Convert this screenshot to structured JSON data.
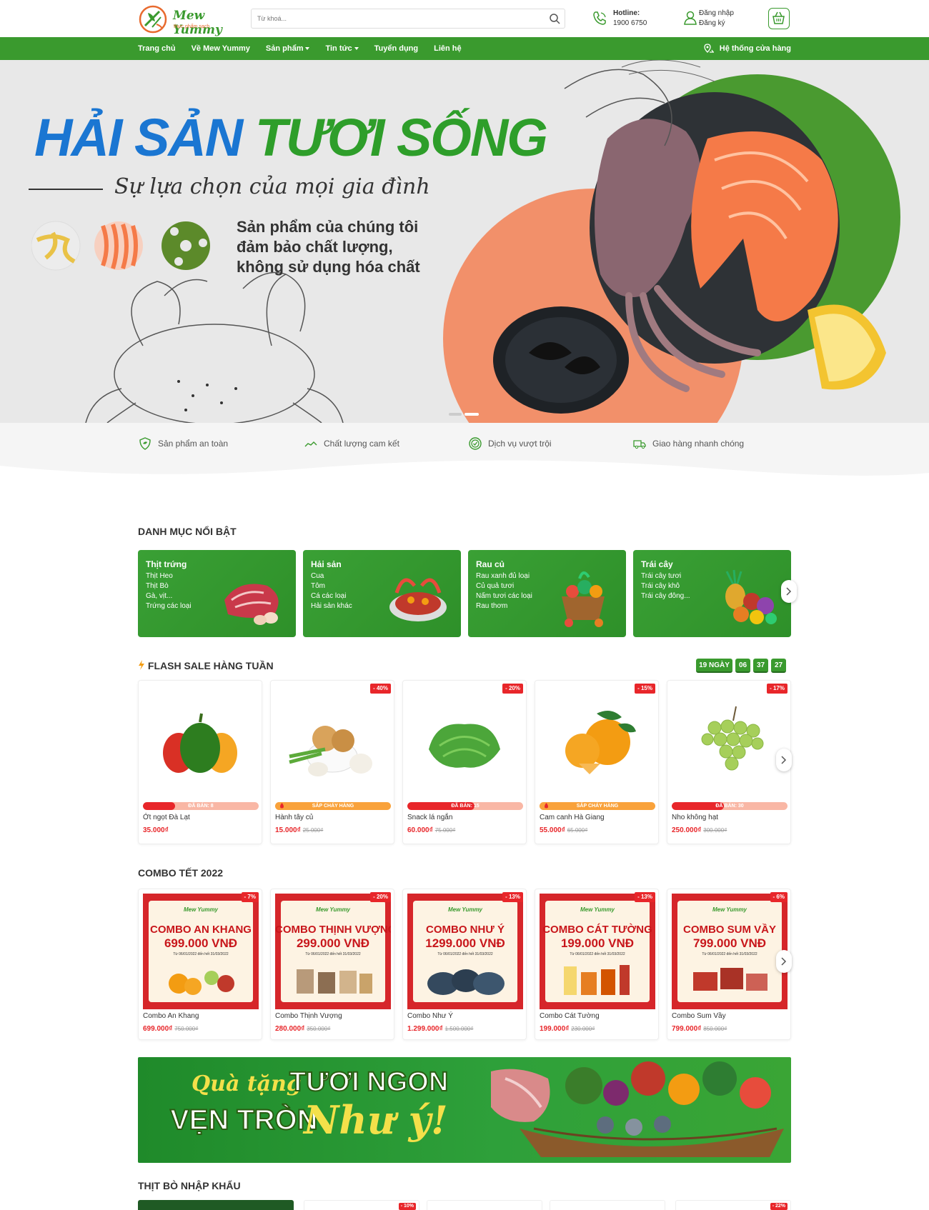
{
  "header": {
    "brand_name": "Mew Yummy",
    "brand_tagline": "thực phẩm sạch",
    "search_placeholder": "Từ khoá...",
    "hotline_label": "Hotline:",
    "hotline_number": "1900 6750",
    "login": "Đăng nhập",
    "register": "Đăng ký"
  },
  "nav": {
    "items": [
      "Trang chủ",
      "Về Mew Yummy",
      "Sản phẩm",
      "Tin tức",
      "Tuyển dụng",
      "Liên hệ"
    ],
    "stores": "Hệ thống cửa hàng"
  },
  "hero": {
    "title_part1": "HẢI SẢN",
    "title_part2": "TƯƠI SỐNG",
    "subtitle": "Sự lựa chọn của mọi gia đình",
    "desc": "Sản phẩm của chúng tôi đảm bảo chất lượng, không sử dụng hóa chất"
  },
  "features": [
    "Sản phẩm an toàn",
    "Chất lượng cam kết",
    "Dịch vụ vượt trội",
    "Giao hàng nhanh chóng"
  ],
  "categories": {
    "title": "DANH MỤC NỔI BẬT",
    "items": [
      {
        "name": "Thịt trứng",
        "sub": [
          "Thịt Heo",
          "Thịt Bò",
          "Gà, vịt...",
          "Trứng các loại"
        ]
      },
      {
        "name": "Hải sản",
        "sub": [
          "Cua",
          "Tôm",
          "Cá các loại",
          "Hải sản khác"
        ]
      },
      {
        "name": "Rau củ",
        "sub": [
          "Rau xanh đủ loại",
          "Củ quả tươi",
          "Nấm tươi các loại",
          "Rau thơm"
        ]
      },
      {
        "name": "Trái cây",
        "sub": [
          "Trái cây tươi",
          "Trái cây khô",
          "Trái cây đông..."
        ]
      }
    ]
  },
  "flash_sale": {
    "title": "FLASH SALE HÀNG TUẦN",
    "countdown": {
      "days": "19 NGÀY",
      "hours": "06",
      "minutes": "37",
      "seconds": "27"
    },
    "products": [
      {
        "name": "Ớt ngọt Đà Lạt",
        "price": "35.000₫",
        "old_price": "",
        "discount": "",
        "bar_text": "ĐÃ BÁN: 8",
        "bar_fill": 0.28,
        "hot": false
      },
      {
        "name": "Hành tây củ",
        "price": "15.000₫",
        "old_price": "25.000₫",
        "discount": "- 40%",
        "bar_text": "SẮP CHÁY HÀNG",
        "bar_fill": 0.9,
        "hot": true
      },
      {
        "name": "Snack lá ngắn",
        "price": "60.000₫",
        "old_price": "75.000₫",
        "discount": "- 20%",
        "bar_text": "ĐÃ BÁN: 15",
        "bar_fill": 0.58,
        "hot": false
      },
      {
        "name": "Cam canh Hà Giang",
        "price": "55.000₫",
        "old_price": "65.000₫",
        "discount": "- 15%",
        "bar_text": "SẮP CHÁY HÀNG",
        "bar_fill": 0.9,
        "hot": true
      },
      {
        "name": "Nho không hạt",
        "price": "250.000₫",
        "old_price": "300.000₫",
        "discount": "- 17%",
        "bar_text": "ĐÃ BÁN: 30",
        "bar_fill": 0.45,
        "hot": false
      }
    ]
  },
  "combo": {
    "title": "COMBO TẾT 2022",
    "products": [
      {
        "name": "Combo An Khang",
        "price": "699.000₫",
        "old_price": "750.000₫",
        "discount": "- 7%",
        "banner_title": "COMBO AN KHANG",
        "banner_price": "699.000 VNĐ"
      },
      {
        "name": "Combo Thịnh Vượng",
        "price": "280.000₫",
        "old_price": "350.000₫",
        "discount": "- 20%",
        "banner_title": "COMBO THỊNH VƯỢNG",
        "banner_price": "299.000 VNĐ"
      },
      {
        "name": "Combo Như Ý",
        "price": "1.299.000₫",
        "old_price": "1.500.000₫",
        "discount": "- 13%",
        "banner_title": "COMBO NHƯ Ý",
        "banner_price": "1299.000 VNĐ"
      },
      {
        "name": "Combo Cát Tường",
        "price": "199.000₫",
        "old_price": "230.000₫",
        "discount": "- 13%",
        "banner_title": "COMBO CÁT TƯỜNG",
        "banner_price": "199.000 VNĐ"
      },
      {
        "name": "Combo Sum Vầy",
        "price": "799.000₫",
        "old_price": "850.000₫",
        "discount": "- 6%",
        "banner_title": "COMBO SUM VẦY",
        "banner_price": "799.000 VNĐ"
      }
    ],
    "banner_dates": "Từ 06/01/2022 đến hết 31/03/2022"
  },
  "promo": {
    "line1": "Quà tặng",
    "line2": "TƯƠI NGON",
    "line3": "VẸN TRÒN",
    "line4": "Như ý!"
  },
  "beef": {
    "title": "THỊT BÒ NHẬP KHẨU",
    "discounts": [
      "- 10%",
      "- 22%"
    ]
  },
  "colors": {
    "primary_green": "#3a9a2e",
    "sale_red": "#e8262a",
    "hero_blue": "#1a76d2",
    "hero_orange": "#f2906a"
  }
}
